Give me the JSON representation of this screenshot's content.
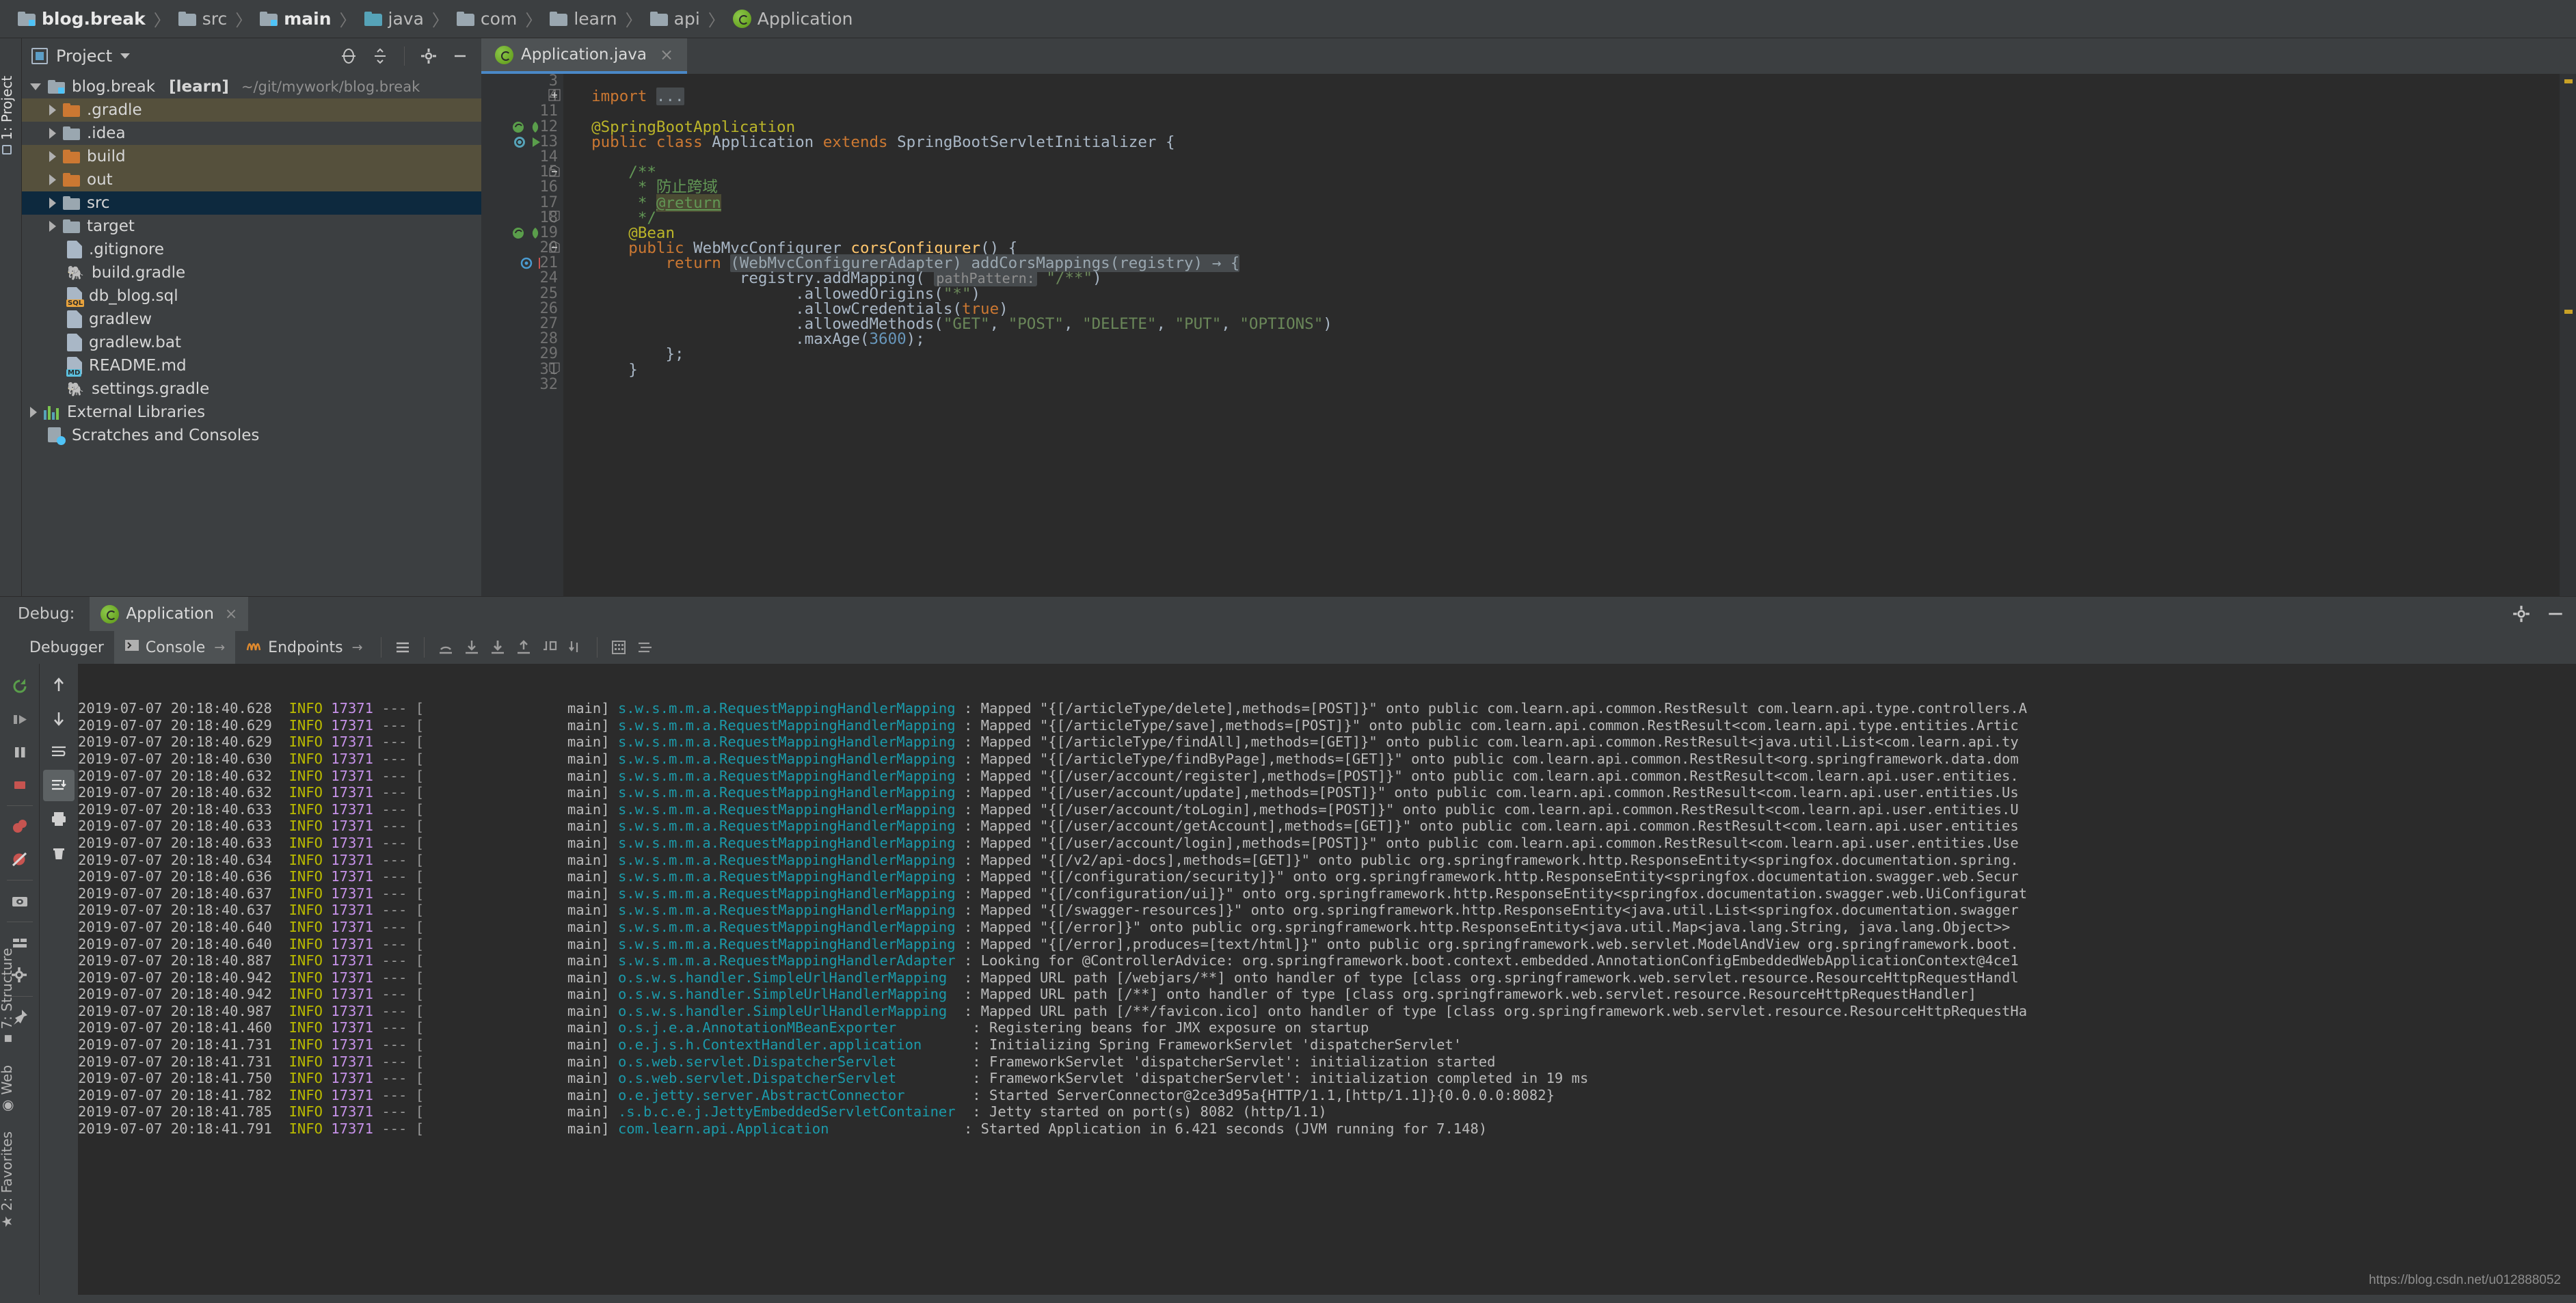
{
  "breadcrumb": {
    "items": [
      {
        "label": "blog.break",
        "icon": "folder-module-icon",
        "bold": true
      },
      {
        "label": "src",
        "icon": "folder-icon",
        "bold": false
      },
      {
        "label": "main",
        "icon": "folder-module-icon",
        "bold": true
      },
      {
        "label": "java",
        "icon": "folder-source-icon",
        "bold": false
      },
      {
        "label": "com",
        "icon": "folder-package-icon",
        "bold": false
      },
      {
        "label": "learn",
        "icon": "folder-package-icon",
        "bold": false
      },
      {
        "label": "api",
        "icon": "folder-package-icon",
        "bold": false
      },
      {
        "label": "Application",
        "icon": "spring-class-icon",
        "bold": false
      }
    ]
  },
  "project_panel": {
    "title": "Project",
    "header_icons": [
      "locate-icon",
      "collapse-all-icon",
      "settings-gear-icon",
      "hide-icon"
    ],
    "tree": [
      {
        "label": "blog.break",
        "suffix": "[learn]",
        "path": "~/git/mywork/blog.break",
        "indent": 0,
        "arrow": "down",
        "icon": "folder-module-icon",
        "state": "normal"
      },
      {
        "label": ".gradle",
        "indent": 1,
        "arrow": "right",
        "icon": "folder-excluded-icon",
        "state": "tan"
      },
      {
        "label": ".idea",
        "indent": 1,
        "arrow": "right",
        "icon": "folder-icon",
        "state": "normal"
      },
      {
        "label": "build",
        "indent": 1,
        "arrow": "right",
        "icon": "folder-excluded-icon",
        "state": "tan"
      },
      {
        "label": "out",
        "indent": 1,
        "arrow": "right",
        "icon": "folder-excluded-icon",
        "state": "tan"
      },
      {
        "label": "src",
        "indent": 1,
        "arrow": "right",
        "icon": "folder-icon",
        "state": "selected"
      },
      {
        "label": "target",
        "indent": 1,
        "arrow": "right",
        "icon": "folder-icon",
        "state": "normal"
      },
      {
        "label": ".gitignore",
        "indent": 1,
        "arrow": "none",
        "icon": "file-icon",
        "state": "normal"
      },
      {
        "label": "build.gradle",
        "indent": 1,
        "arrow": "none",
        "icon": "gradle-icon",
        "state": "normal"
      },
      {
        "label": "db_blog.sql",
        "indent": 1,
        "arrow": "none",
        "icon": "sql-file-icon",
        "state": "normal"
      },
      {
        "label": "gradlew",
        "indent": 1,
        "arrow": "none",
        "icon": "file-icon",
        "state": "normal"
      },
      {
        "label": "gradlew.bat",
        "indent": 1,
        "arrow": "none",
        "icon": "file-icon",
        "state": "normal"
      },
      {
        "label": "README.md",
        "indent": 1,
        "arrow": "none",
        "icon": "markdown-file-icon",
        "state": "normal"
      },
      {
        "label": "settings.gradle",
        "indent": 1,
        "arrow": "none",
        "icon": "gradle-icon",
        "state": "normal"
      },
      {
        "label": "External Libraries",
        "indent": 0,
        "arrow": "right",
        "icon": "libraries-icon",
        "state": "normal"
      },
      {
        "label": "Scratches and Consoles",
        "indent": 0,
        "arrow": "none",
        "icon": "scratches-icon",
        "state": "normal"
      }
    ]
  },
  "left_rail": {
    "top": "1: Project",
    "bottom": [
      "2: Favorites",
      "Web",
      "7: Structure"
    ]
  },
  "editor": {
    "tab": {
      "label": "Application.java",
      "icon": "spring-class-icon",
      "close": "×"
    },
    "lines": [
      {
        "num": "3",
        "gutter": "",
        "tokens": []
      },
      {
        "num": "4",
        "gutter": "fold-plus",
        "tokens": [
          {
            "t": "import ",
            "c": "kw",
            "indent": 2
          },
          {
            "t": "...",
            "c": "fold"
          }
        ]
      },
      {
        "num": "11",
        "gutter": "",
        "tokens": []
      },
      {
        "num": "12",
        "gutter": "bean-run",
        "tokens": [
          {
            "t": "@SpringBootApplication",
            "c": "ann",
            "indent": 2
          }
        ]
      },
      {
        "num": "13",
        "gutter": "spring-run",
        "tokens": [
          {
            "t": "public class ",
            "c": "kw",
            "indent": 2
          },
          {
            "t": "Application ",
            "c": "cls"
          },
          {
            "t": "extends ",
            "c": "kw"
          },
          {
            "t": "SpringBootServletInitializer {",
            "c": "cls"
          }
        ]
      },
      {
        "num": "14",
        "gutter": "",
        "tokens": []
      },
      {
        "num": "15",
        "gutter": "fold-minus",
        "tokens": [
          {
            "t": "/**",
            "c": "cmt",
            "indent": 6
          }
        ]
      },
      {
        "num": "16",
        "gutter": "",
        "tokens": [
          {
            "t": "* 防止跨域",
            "c": "cmt",
            "indent": 7
          }
        ]
      },
      {
        "num": "17",
        "gutter": "",
        "tokens": [
          {
            "t": "* ",
            "c": "cmt",
            "indent": 7
          },
          {
            "t": "@return",
            "c": "jdoc-tag"
          }
        ]
      },
      {
        "num": "18",
        "gutter": "fold-end",
        "tokens": [
          {
            "t": "*/",
            "c": "cmt",
            "indent": 7
          }
        ]
      },
      {
        "num": "19",
        "gutter": "bean-run",
        "tokens": [
          {
            "t": "@Bean",
            "c": "ann",
            "indent": 6
          }
        ]
      },
      {
        "num": "20",
        "gutter": "fold-minus",
        "tokens": [
          {
            "t": "public ",
            "c": "kw",
            "indent": 6
          },
          {
            "t": "WebMvcConfigurer ",
            "c": "cls"
          },
          {
            "t": "corsConfigurer",
            "c": "fn"
          },
          {
            "t": "() {",
            "c": "cls"
          }
        ]
      },
      {
        "num": "21",
        "gutter": "breakpoint",
        "tokens": [
          {
            "t": "return ",
            "c": "kw",
            "indent": 10
          },
          {
            "t": "(WebMvcConfigurerAdapter) addCorsMappings(registry) → {",
            "c": "fold"
          }
        ]
      },
      {
        "num": "24",
        "gutter": "",
        "tokens": [
          {
            "t": "registry.addMapping( ",
            "c": "cls",
            "indent": 18
          },
          {
            "t": "pathPattern:",
            "c": "hint"
          },
          {
            "t": " ",
            "c": "cls"
          },
          {
            "t": "\"/**\"",
            "c": "str"
          },
          {
            "t": ")",
            "c": "cls"
          }
        ]
      },
      {
        "num": "25",
        "gutter": "",
        "tokens": [
          {
            "t": ".allowedOrigins(",
            "c": "cls",
            "indent": 24
          },
          {
            "t": "\"*\"",
            "c": "str"
          },
          {
            "t": ")",
            "c": "cls"
          }
        ]
      },
      {
        "num": "26",
        "gutter": "",
        "tokens": [
          {
            "t": ".allowCredentials(",
            "c": "cls",
            "indent": 24
          },
          {
            "t": "true",
            "c": "kw"
          },
          {
            "t": ")",
            "c": "cls"
          }
        ]
      },
      {
        "num": "27",
        "gutter": "",
        "tokens": [
          {
            "t": ".allowedMethods(",
            "c": "cls",
            "indent": 24
          },
          {
            "t": "\"GET\"",
            "c": "str"
          },
          {
            "t": ", ",
            "c": "cls"
          },
          {
            "t": "\"POST\"",
            "c": "str"
          },
          {
            "t": ", ",
            "c": "cls"
          },
          {
            "t": "\"DELETE\"",
            "c": "str"
          },
          {
            "t": ", ",
            "c": "cls"
          },
          {
            "t": "\"PUT\"",
            "c": "str"
          },
          {
            "t": ", ",
            "c": "cls"
          },
          {
            "t": "\"OPTIONS\"",
            "c": "str"
          },
          {
            "t": ")",
            "c": "cls"
          }
        ]
      },
      {
        "num": "28",
        "gutter": "",
        "tokens": [
          {
            "t": ".maxAge(",
            "c": "cls",
            "indent": 24
          },
          {
            "t": "3600",
            "c": "num"
          },
          {
            "t": ");",
            "c": "cls"
          }
        ]
      },
      {
        "num": "29",
        "gutter": "",
        "tokens": [
          {
            "t": "};",
            "c": "cls",
            "indent": 10
          }
        ]
      },
      {
        "num": "31",
        "gutter": "fold-end",
        "tokens": [
          {
            "t": "}",
            "c": "cls",
            "indent": 6
          }
        ]
      },
      {
        "num": "32",
        "gutter": "",
        "tokens": []
      }
    ]
  },
  "debug": {
    "label": "Debug:",
    "session_tab": {
      "label": "Application",
      "icon": "spring-icon",
      "close": "×"
    },
    "header_icons": [
      "settings-gear-icon",
      "hide-icon"
    ],
    "tabs": [
      {
        "label": "Debugger",
        "icon": "",
        "active": false
      },
      {
        "label": "Console",
        "icon": "console-icon",
        "active": true,
        "pin": "→"
      },
      {
        "label": "Endpoints",
        "icon": "endpoints-icon",
        "active": false,
        "pin": "→"
      }
    ],
    "toolbar_icons": [
      "layout-icon",
      "step-over-icon",
      "step-into-icon",
      "force-step-into-icon",
      "step-out-icon",
      "drop-frame-icon",
      "run-to-cursor-icon",
      "evaluate-icon",
      "mute-breakpoints-icon"
    ],
    "actions_left": [
      "rerun-icon",
      "resume-icon",
      "pause-icon",
      "stop-icon",
      "view-breakpoints-icon",
      "mute-breakpoints-icon",
      "screenshot-icon",
      "layout-settings-icon",
      "settings-gear-icon",
      "pin-icon"
    ],
    "actions_right": [
      "scroll-up-icon",
      "scroll-down-icon",
      "soft-wrap-icon",
      "scroll-to-end-icon",
      "print-icon",
      "clear-all-icon"
    ]
  },
  "console_log": {
    "lines": [
      {
        "ts": "2019-07-07 20:18:40.628",
        "lvl": "INFO",
        "pid": "17371",
        "thread": "main",
        "logger": "s.w.s.m.m.a.RequestMappingHandlerMapping",
        "msg": ": Mapped \"{[/articleType/delete],methods=[POST]}\" onto public com.learn.api.common.RestResult com.learn.api.type.controllers.A"
      },
      {
        "ts": "2019-07-07 20:18:40.629",
        "lvl": "INFO",
        "pid": "17371",
        "thread": "main",
        "logger": "s.w.s.m.m.a.RequestMappingHandlerMapping",
        "msg": ": Mapped \"{[/articleType/save],methods=[POST]}\" onto public com.learn.api.common.RestResult<com.learn.api.type.entities.Artic"
      },
      {
        "ts": "2019-07-07 20:18:40.629",
        "lvl": "INFO",
        "pid": "17371",
        "thread": "main",
        "logger": "s.w.s.m.m.a.RequestMappingHandlerMapping",
        "msg": ": Mapped \"{[/articleType/findAll],methods=[GET]}\" onto public com.learn.api.common.RestResult<java.util.List<com.learn.api.ty"
      },
      {
        "ts": "2019-07-07 20:18:40.630",
        "lvl": "INFO",
        "pid": "17371",
        "thread": "main",
        "logger": "s.w.s.m.m.a.RequestMappingHandlerMapping",
        "msg": ": Mapped \"{[/articleType/findByPage],methods=[GET]}\" onto public com.learn.api.common.RestResult<org.springframework.data.dom"
      },
      {
        "ts": "2019-07-07 20:18:40.632",
        "lvl": "INFO",
        "pid": "17371",
        "thread": "main",
        "logger": "s.w.s.m.m.a.RequestMappingHandlerMapping",
        "msg": ": Mapped \"{[/user/account/register],methods=[POST]}\" onto public com.learn.api.common.RestResult<com.learn.api.user.entities."
      },
      {
        "ts": "2019-07-07 20:18:40.632",
        "lvl": "INFO",
        "pid": "17371",
        "thread": "main",
        "logger": "s.w.s.m.m.a.RequestMappingHandlerMapping",
        "msg": ": Mapped \"{[/user/account/update],methods=[POST]}\" onto public com.learn.api.common.RestResult<com.learn.api.user.entities.Us"
      },
      {
        "ts": "2019-07-07 20:18:40.633",
        "lvl": "INFO",
        "pid": "17371",
        "thread": "main",
        "logger": "s.w.s.m.m.a.RequestMappingHandlerMapping",
        "msg": ": Mapped \"{[/user/account/toLogin],methods=[POST]}\" onto public com.learn.api.common.RestResult<com.learn.api.user.entities.U"
      },
      {
        "ts": "2019-07-07 20:18:40.633",
        "lvl": "INFO",
        "pid": "17371",
        "thread": "main",
        "logger": "s.w.s.m.m.a.RequestMappingHandlerMapping",
        "msg": ": Mapped \"{[/user/account/getAccount],methods=[GET]}\" onto public com.learn.api.common.RestResult<com.learn.api.user.entities"
      },
      {
        "ts": "2019-07-07 20:18:40.633",
        "lvl": "INFO",
        "pid": "17371",
        "thread": "main",
        "logger": "s.w.s.m.m.a.RequestMappingHandlerMapping",
        "msg": ": Mapped \"{[/user/account/login],methods=[POST]}\" onto public com.learn.api.common.RestResult<com.learn.api.user.entities.Use"
      },
      {
        "ts": "2019-07-07 20:18:40.634",
        "lvl": "INFO",
        "pid": "17371",
        "thread": "main",
        "logger": "s.w.s.m.m.a.RequestMappingHandlerMapping",
        "msg": ": Mapped \"{[/v2/api-docs],methods=[GET]}\" onto public org.springframework.http.ResponseEntity<springfox.documentation.spring."
      },
      {
        "ts": "2019-07-07 20:18:40.636",
        "lvl": "INFO",
        "pid": "17371",
        "thread": "main",
        "logger": "s.w.s.m.m.a.RequestMappingHandlerMapping",
        "msg": ": Mapped \"{[/configuration/security]}\" onto org.springframework.http.ResponseEntity<springfox.documentation.swagger.web.Secur"
      },
      {
        "ts": "2019-07-07 20:18:40.637",
        "lvl": "INFO",
        "pid": "17371",
        "thread": "main",
        "logger": "s.w.s.m.m.a.RequestMappingHandlerMapping",
        "msg": ": Mapped \"{[/configuration/ui]}\" onto org.springframework.http.ResponseEntity<springfox.documentation.swagger.web.UiConfigurat"
      },
      {
        "ts": "2019-07-07 20:18:40.637",
        "lvl": "INFO",
        "pid": "17371",
        "thread": "main",
        "logger": "s.w.s.m.m.a.RequestMappingHandlerMapping",
        "msg": ": Mapped \"{[/swagger-resources]}\" onto org.springframework.http.ResponseEntity<java.util.List<springfox.documentation.swagger"
      },
      {
        "ts": "2019-07-07 20:18:40.640",
        "lvl": "INFO",
        "pid": "17371",
        "thread": "main",
        "logger": "s.w.s.m.m.a.RequestMappingHandlerMapping",
        "msg": ": Mapped \"{[/error]}\" onto public org.springframework.http.ResponseEntity<java.util.Map<java.lang.String, java.lang.Object>> "
      },
      {
        "ts": "2019-07-07 20:18:40.640",
        "lvl": "INFO",
        "pid": "17371",
        "thread": "main",
        "logger": "s.w.s.m.m.a.RequestMappingHandlerMapping",
        "msg": ": Mapped \"{[/error],produces=[text/html]}\" onto public org.springframework.web.servlet.ModelAndView org.springframework.boot."
      },
      {
        "ts": "2019-07-07 20:18:40.887",
        "lvl": "INFO",
        "pid": "17371",
        "thread": "main",
        "logger": "s.w.s.m.m.a.RequestMappingHandlerAdapter",
        "msg": ": Looking for @ControllerAdvice: org.springframework.boot.context.embedded.AnnotationConfigEmbeddedWebApplicationContext@4ce1"
      },
      {
        "ts": "2019-07-07 20:18:40.942",
        "lvl": "INFO",
        "pid": "17371",
        "thread": "main",
        "logger": "o.s.w.s.handler.SimpleUrlHandlerMapping ",
        "msg": ": Mapped URL path [/webjars/**] onto handler of type [class org.springframework.web.servlet.resource.ResourceHttpRequestHandl"
      },
      {
        "ts": "2019-07-07 20:18:40.942",
        "lvl": "INFO",
        "pid": "17371",
        "thread": "main",
        "logger": "o.s.w.s.handler.SimpleUrlHandlerMapping ",
        "msg": ": Mapped URL path [/**] onto handler of type [class org.springframework.web.servlet.resource.ResourceHttpRequestHandler]"
      },
      {
        "ts": "2019-07-07 20:18:40.987",
        "lvl": "INFO",
        "pid": "17371",
        "thread": "main",
        "logger": "o.s.w.s.handler.SimpleUrlHandlerMapping ",
        "msg": ": Mapped URL path [/**/favicon.ico] onto handler of type [class org.springframework.web.servlet.resource.ResourceHttpRequestHa"
      },
      {
        "ts": "2019-07-07 20:18:41.460",
        "lvl": "INFO",
        "pid": "17371",
        "thread": "main",
        "logger": "o.s.j.e.a.AnnotationMBeanExporter        ",
        "msg": ": Registering beans for JMX exposure on startup"
      },
      {
        "ts": "2019-07-07 20:18:41.731",
        "lvl": "INFO",
        "pid": "17371",
        "thread": "main",
        "logger": "o.e.j.s.h.ContextHandler.application     ",
        "msg": ": Initializing Spring FrameworkServlet 'dispatcherServlet'"
      },
      {
        "ts": "2019-07-07 20:18:41.731",
        "lvl": "INFO",
        "pid": "17371",
        "thread": "main",
        "logger": "o.s.web.servlet.DispatcherServlet        ",
        "msg": ": FrameworkServlet 'dispatcherServlet': initialization started"
      },
      {
        "ts": "2019-07-07 20:18:41.750",
        "lvl": "INFO",
        "pid": "17371",
        "thread": "main",
        "logger": "o.s.web.servlet.DispatcherServlet        ",
        "msg": ": FrameworkServlet 'dispatcherServlet': initialization completed in 19 ms"
      },
      {
        "ts": "2019-07-07 20:18:41.782",
        "lvl": "INFO",
        "pid": "17371",
        "thread": "main",
        "logger": "o.e.jetty.server.AbstractConnector       ",
        "msg": ": Started ServerConnector@2ce3d95a{HTTP/1.1,[http/1.1]}{0.0.0.0:8082}"
      },
      {
        "ts": "2019-07-07 20:18:41.785",
        "lvl": "INFO",
        "pid": "17371",
        "thread": "main",
        "logger": ".s.b.c.e.j.JettyEmbeddedServletContainer ",
        "msg": ": Jetty started on port(s) 8082 (http/1.1)"
      },
      {
        "ts": "2019-07-07 20:18:41.791",
        "lvl": "INFO",
        "pid": "17371",
        "thread": "main",
        "logger": "com.learn.api.Application               ",
        "msg": ": Started Application in 6.421 seconds (JVM running for 7.148)"
      }
    ]
  },
  "watermark": "https://blog.csdn.net/u012888052",
  "colors": {
    "accent_blue": "#4a88c7",
    "panel_bg": "#3c3f41",
    "editor_bg": "#2b2b2b",
    "selected_row": "#0d293e",
    "excluded_row": "#55503c",
    "logger_teal": "#1b9aaa",
    "level_yellow": "#bbbb00",
    "pid_purple": "#c792ea"
  }
}
